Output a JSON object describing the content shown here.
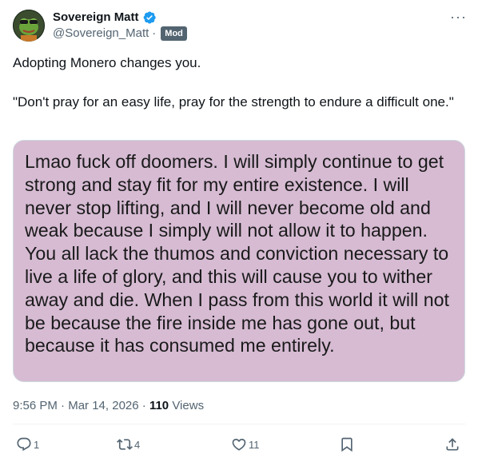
{
  "author": {
    "display_name": "Sovereign Matt",
    "handle": "@Sovereign_Matt",
    "separator": "·",
    "badge": "Mod",
    "verified": true
  },
  "more_icon": "more-dots-icon",
  "tweet": {
    "line1": "Adopting Monero changes you.",
    "line2": "\"Don't pray for an easy life, pray for the strength to endure a difficult one.\""
  },
  "media": {
    "text": "Lmao fuck off doomers. I will simply continue to get strong and stay fit for my entire existence. I will never stop lifting, and I will never become old and weak because I simply will not allow it to happen. You all lack the thumos and conviction necessary to live a life of glory, and this will cause you to wither away and die. When I pass from this world it will not be because the fire inside me has gone out, but because it has consumed me entirely.",
    "background": "#d6bbd3"
  },
  "meta": {
    "time": "9:56 PM",
    "sep1": "·",
    "date": "Mar 14, 2026",
    "sep2": "·",
    "views_count": "110",
    "views_label": "Views"
  },
  "actions": {
    "replies": "1",
    "reposts": "4",
    "likes": "11"
  },
  "colors": {
    "accent": "#1d9bf0",
    "muted": "#536471",
    "text": "#0f1419"
  }
}
